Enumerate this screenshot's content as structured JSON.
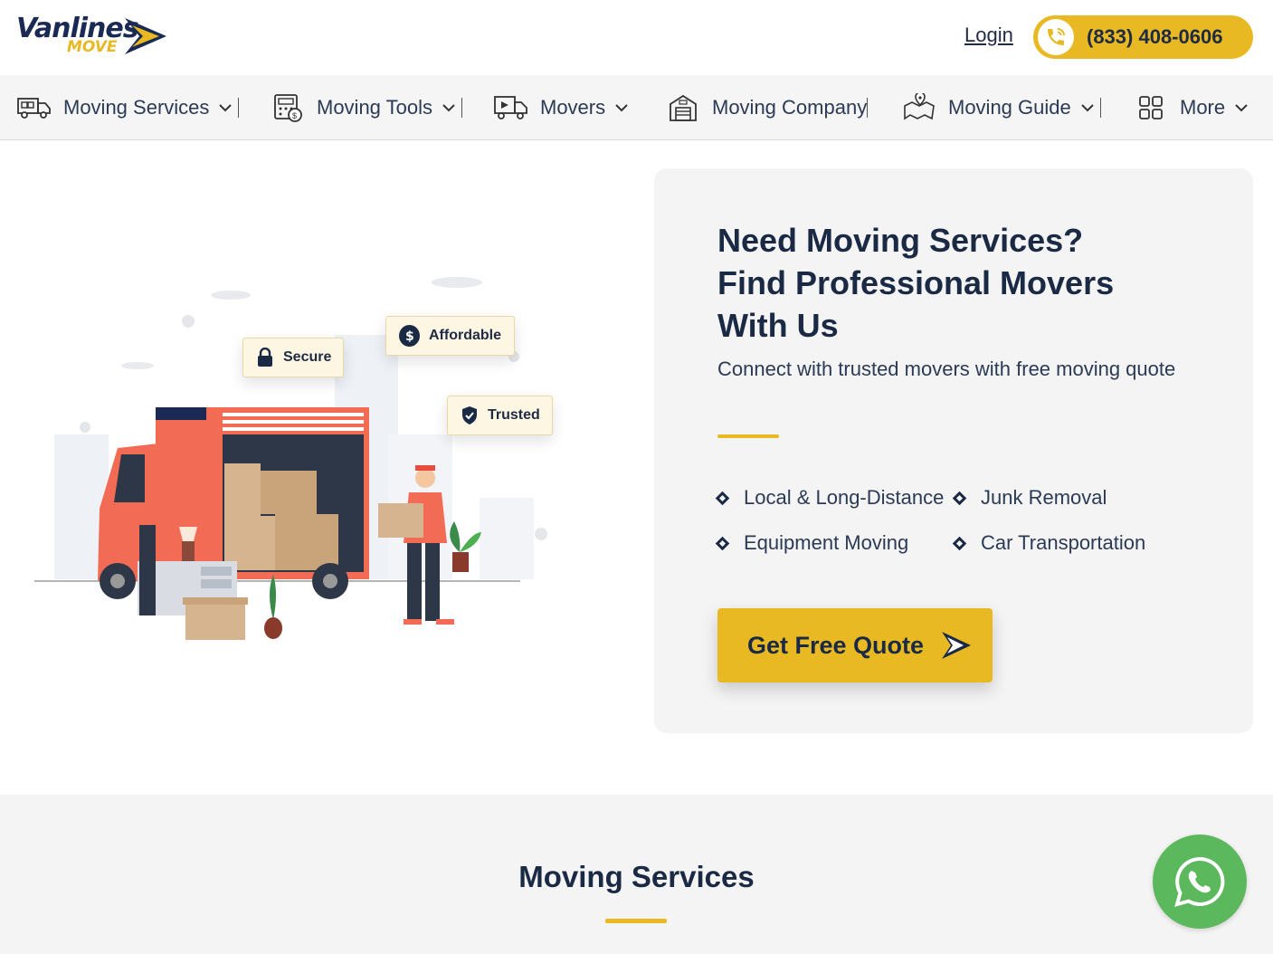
{
  "header": {
    "logo_text": "Vanlines",
    "logo_sub": "MOVE",
    "login_label": "Login",
    "phone": "(833) 408-0606"
  },
  "nav": {
    "items": [
      {
        "label": "Moving Services",
        "icon": "truck-icon"
      },
      {
        "label": "Moving Tools",
        "icon": "calculator-icon"
      },
      {
        "label": "Movers",
        "icon": "delivery-truck-icon"
      },
      {
        "label": "Moving Company",
        "icon": "warehouse-icon"
      },
      {
        "label": "Moving Guide",
        "icon": "map-pin-icon"
      },
      {
        "label": "More",
        "icon": "grid-icon"
      }
    ]
  },
  "hero": {
    "badges": [
      "Secure",
      "Affordable",
      "Trusted"
    ],
    "title_lines": [
      "Need Moving Services?",
      "Find Professional Movers",
      "With Us"
    ],
    "subtitle": "Connect with trusted movers with free moving quote",
    "features": [
      "Local & Long-Distance",
      "Junk Removal",
      "Equipment Moving",
      "Car Transportation"
    ],
    "cta_label": "Get Free Quote"
  },
  "section2": {
    "title": "Moving Services"
  },
  "colors": {
    "accent": "#e8b923",
    "navy": "#1b2a44",
    "whatsapp": "#5cb85c"
  }
}
